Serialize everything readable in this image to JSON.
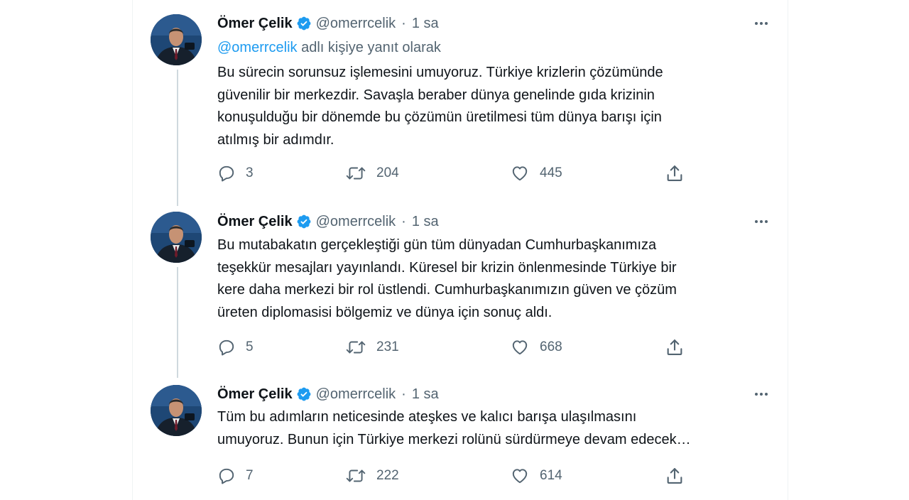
{
  "colors": {
    "accent": "#1d9bf0",
    "text": "#0f1419",
    "muted": "#536471",
    "thread_line": "#cfd9de"
  },
  "tweets": [
    {
      "author_name": "Ömer Çelik",
      "handle": "@omerrcelik",
      "separator": "·",
      "time": "1 sa",
      "replying_mention": "@omerrcelik",
      "replying_suffix": " adlı kişiye yanıt olarak",
      "text_lines": [
        "Bu sürecin sorunsuz işlemesini umuyoruz. Türkiye krizlerin çözümünde",
        "güvenilir bir merkezdir. Savaşla beraber dünya genelinde gıda krizinin",
        "konuşulduğu bir dönemde bu çözümün üretilmesi tüm dünya barışı için",
        "atılmış bir adımdır."
      ],
      "replies": "3",
      "retweets": "204",
      "likes": "445",
      "icons": [
        "verified-badge-icon",
        "more-icon",
        "reply-icon",
        "retweet-icon",
        "like-icon",
        "share-icon"
      ]
    },
    {
      "author_name": "Ömer Çelik",
      "handle": "@omerrcelik",
      "separator": "·",
      "time": "1 sa",
      "text_lines": [
        "Bu mutabakatın gerçekleştiği gün tüm dünyadan Cumhurbaşkanımıza",
        "teşekkür mesajları yayınlandı. Küresel bir krizin önlenmesinde Türkiye bir",
        "kere daha merkezi bir rol üstlendi. Cumhurbaşkanımızın güven ve çözüm",
        "üreten diplomasisi bölgemiz ve dünya için sonuç aldı."
      ],
      "replies": "5",
      "retweets": "231",
      "likes": "668"
    },
    {
      "author_name": "Ömer Çelik",
      "handle": "@omerrcelik",
      "separator": "·",
      "time": "1 sa",
      "text_lines": [
        "Tüm bu adımların neticesinde ateşkes ve kalıcı barışa ulaşılmasını",
        "umuyoruz. Bunun için Türkiye merkezi rolünü sürdürmeye devam edecek…"
      ],
      "replies": "7",
      "retweets": "222",
      "likes": "614"
    }
  ]
}
